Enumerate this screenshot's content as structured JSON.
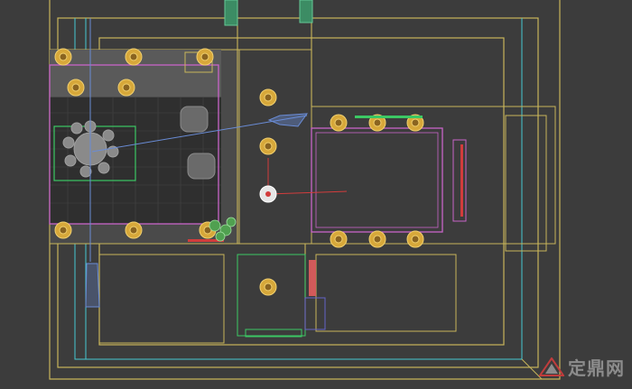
{
  "viewport": {
    "name": "autocad-floor-plan-viewport",
    "colors": {
      "background": "#3c3c3c",
      "wall_yellow": "#c8b55a",
      "cyan": "#46c8d2",
      "magenta": "#c864c8",
      "red": "#d23c3c",
      "white": "#e6e6e6",
      "green": "#3cc864",
      "light_fixture": "#d7a83a"
    }
  },
  "watermark": {
    "text": "定鼎网",
    "logo_icon": "dingding-logo-icon"
  }
}
